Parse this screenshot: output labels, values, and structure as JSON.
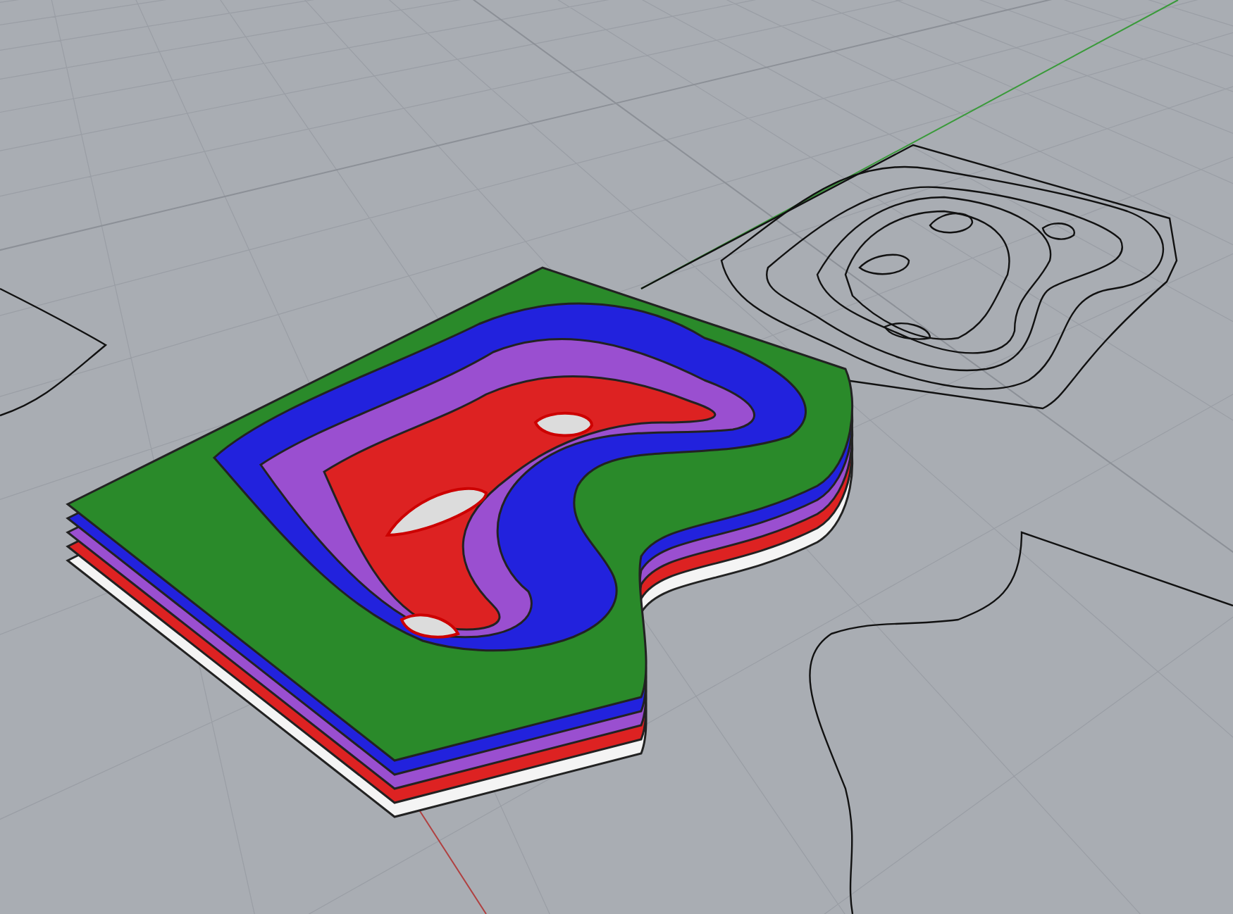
{
  "model": {
    "layers": [
      {
        "color": "#2a8a2a"
      },
      {
        "color": "#2222dd"
      },
      {
        "color": "#9a4fd0"
      },
      {
        "color": "#dd2222"
      },
      {
        "color": "#f4f4f4"
      }
    ]
  }
}
